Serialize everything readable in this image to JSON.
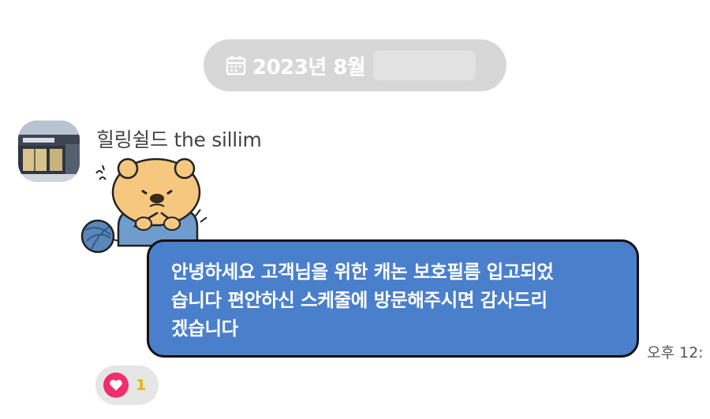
{
  "date_divider": {
    "text": "2023년 8월",
    "icon": "calendar-icon"
  },
  "message": {
    "sender": "힐링쉴드 the sillim",
    "text": "안녕하세요 고객님을 위한 캐논 보호필름 입고되었습니다 편안하신 스케줄에 방문해주시면 감사드리겠습니다",
    "lines": [
      "안녕하세요 고객님을 위한 캐논 보호필름 입고되었",
      "습니다 편안하신 스케줄에 방문해주시면 감사드리",
      "겠습니다"
    ],
    "time": "오후 12:",
    "sticker": "bear-knitting-sticker"
  },
  "reaction": {
    "icon": "heart-icon",
    "count": "1"
  },
  "colors": {
    "bubble": "#4a7fcb",
    "date_pill": "#d7d7d7",
    "reaction_heart": "#f02d6d",
    "reaction_count": "#e8b400"
  }
}
